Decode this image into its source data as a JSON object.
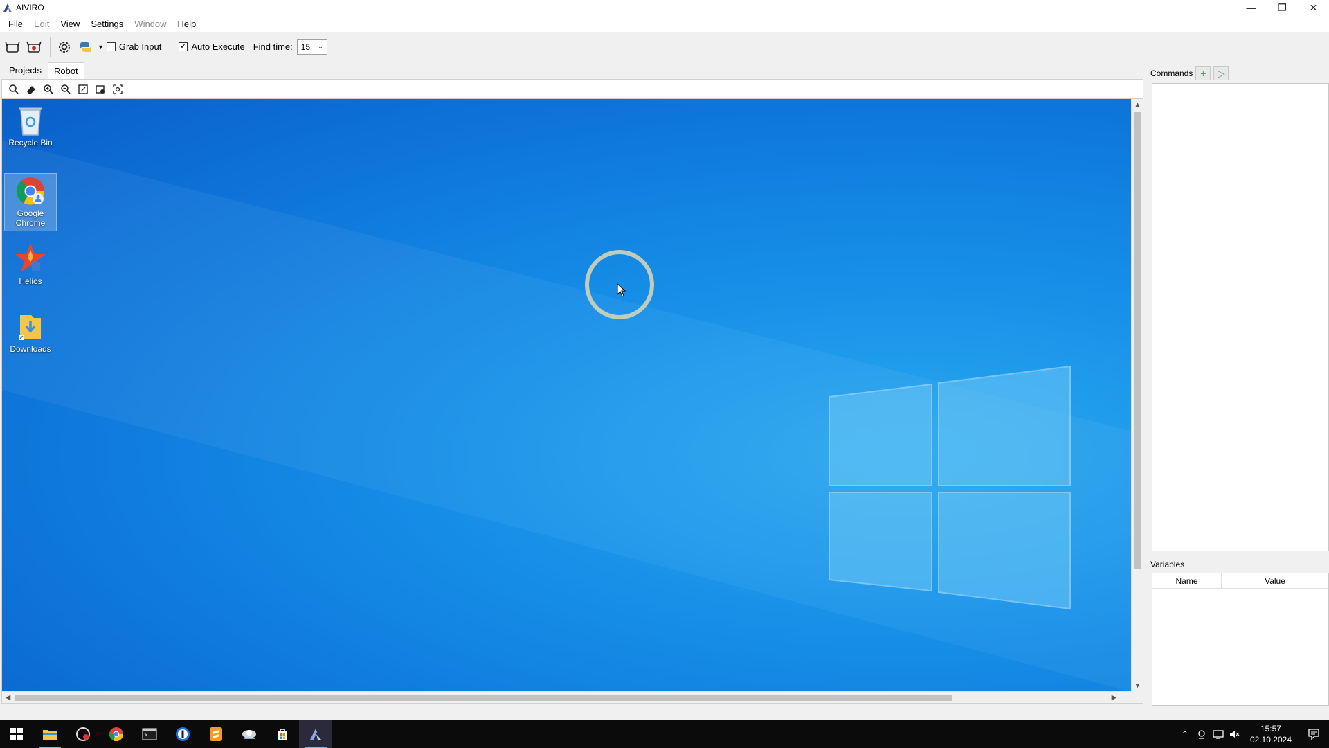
{
  "window": {
    "title": "AIVIRO"
  },
  "menu": [
    "File",
    "Edit",
    "View",
    "Settings",
    "Window",
    "Help"
  ],
  "menu_disabled": [
    "Edit",
    "Window"
  ],
  "toolbar": {
    "grab_input_label": "Grab Input",
    "grab_input_checked": false,
    "auto_execute_label": "Auto Execute",
    "auto_execute_checked": true,
    "find_time_label": "Find time:",
    "find_time_value": "15"
  },
  "tabs": [
    "Projects",
    "Robot"
  ],
  "active_tab": "Robot",
  "desktop_icons": [
    {
      "label": "Recycle Bin"
    },
    {
      "label": "Google Chrome"
    },
    {
      "label": "Helios"
    },
    {
      "label": "Downloads"
    }
  ],
  "right_panel": {
    "commands_label": "Commands",
    "variables_label": "Variables",
    "variables_columns": [
      "Name",
      "Value"
    ]
  },
  "taskbar": {
    "time": "15:57",
    "date": "02.10.2024"
  },
  "colors": {
    "accent": "#77b4ff",
    "desktop": "#1690e8",
    "taskbar": "#0b0b0b"
  }
}
